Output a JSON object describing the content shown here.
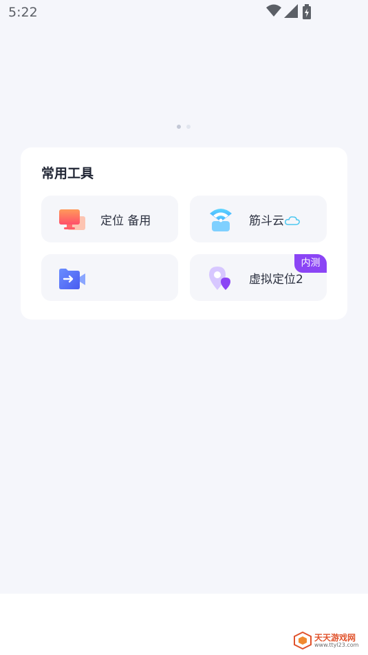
{
  "status_bar": {
    "time": "5:22",
    "icons": [
      "wifi-icon",
      "cell-signal-icon",
      "battery-charging-icon"
    ]
  },
  "pager": {
    "count": 2,
    "active_index": 0
  },
  "tools_card": {
    "title": "常用工具",
    "tiles": [
      {
        "label": "定位 备用",
        "icon": "monitor-icon",
        "badge": ""
      },
      {
        "label": "筋斗云",
        "icon": "wifi-chat-icon",
        "badge": ""
      },
      {
        "label": "",
        "icon": "video-transfer-icon",
        "badge": ""
      },
      {
        "label": "虚拟定位2",
        "icon": "location-pin-icon",
        "badge": "内测"
      }
    ]
  },
  "watermark": {
    "text": "天天游戏网",
    "url": "www.ttyl23.com"
  },
  "colors": {
    "background": "#f5f6fb",
    "card": "#ffffff",
    "tile": "#f5f6fa",
    "badge": "#8b45f5",
    "title_text": "#1f2433"
  }
}
